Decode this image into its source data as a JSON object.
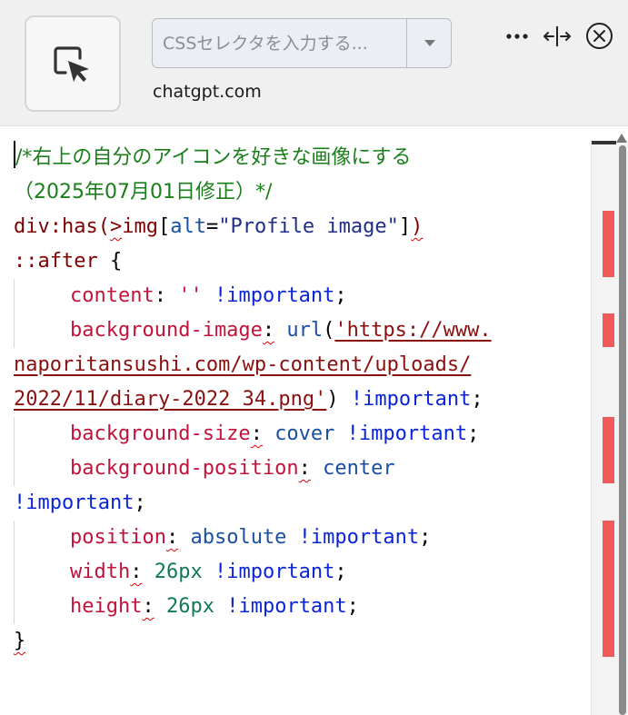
{
  "toolbar": {
    "picker_icon": "element-picker-icon",
    "selector_placeholder": "CSSセレクタを入力する...",
    "selector_value": "",
    "domain": "chatgpt.com",
    "more_icon": "more-dots-icon",
    "split_icon": "split-view-icon",
    "close_icon": "close-circle-icon"
  },
  "editor": {
    "lines": [
      [
        {
          "t": "/*右上の自分のアイコンを好きな画像にする",
          "c": "c-comment"
        }
      ],
      [
        {
          "t": "（2025年07月01日修正）*/",
          "c": "c-comment"
        }
      ],
      [
        {
          "t": "div:has(",
          "c": "c-sel"
        },
        {
          "t": ">",
          "c": "c-sel squig"
        },
        {
          "t": "img",
          "c": "c-sel"
        },
        {
          "t": "[",
          "c": "c-punc"
        },
        {
          "t": "alt",
          "c": "c-attr"
        },
        {
          "t": "=",
          "c": "c-punc"
        },
        {
          "t": "\"Profile image\"",
          "c": "c-str"
        },
        {
          "t": "]",
          "c": "c-punc"
        },
        {
          "t": ")",
          "c": "c-sel squig"
        }
      ],
      [
        {
          "t": "::after ",
          "c": "c-sel"
        },
        {
          "t": "{",
          "c": "c-punc"
        }
      ],
      [
        {
          "ind": 1
        },
        {
          "t": "content",
          "c": "c-prop"
        },
        {
          "t": ": ",
          "c": "c-punc"
        },
        {
          "t": "''",
          "c": "c-prop"
        },
        {
          "t": " ",
          "c": "c-punc"
        },
        {
          "t": "!important",
          "c": "c-imp"
        },
        {
          "t": ";",
          "c": "c-punc"
        }
      ],
      [
        {
          "ind": 1
        },
        {
          "t": "background-image",
          "c": "c-prop"
        },
        {
          "t": ":",
          "c": "c-punc squig"
        },
        {
          "t": " ",
          "c": "c-punc"
        },
        {
          "t": "url",
          "c": "c-val"
        },
        {
          "t": "(",
          "c": "c-punc"
        },
        {
          "t": "'https://www.",
          "c": "c-url"
        }
      ],
      [
        {
          "t": "naporitansushi.com/wp-content/uploads/",
          "c": "c-url"
        }
      ],
      [
        {
          "t": "2022/11/diary-2022_34.png'",
          "c": "c-url"
        },
        {
          "t": ") ",
          "c": "c-punc"
        },
        {
          "t": "!important",
          "c": "c-imp"
        },
        {
          "t": ";",
          "c": "c-punc"
        }
      ],
      [
        {
          "ind": 1
        },
        {
          "t": "background-size",
          "c": "c-prop"
        },
        {
          "t": ":",
          "c": "c-punc squig"
        },
        {
          "t": " ",
          "c": "c-punc"
        },
        {
          "t": "cover",
          "c": "c-val"
        },
        {
          "t": " ",
          "c": "c-punc"
        },
        {
          "t": "!important",
          "c": "c-imp"
        },
        {
          "t": ";",
          "c": "c-punc"
        }
      ],
      [
        {
          "ind": 1
        },
        {
          "t": "background-position",
          "c": "c-prop"
        },
        {
          "t": ":",
          "c": "c-punc squig"
        },
        {
          "t": " ",
          "c": "c-punc"
        },
        {
          "t": "center",
          "c": "c-val"
        }
      ],
      [
        {
          "t": "!important",
          "c": "c-imp"
        },
        {
          "t": ";",
          "c": "c-punc"
        }
      ],
      [
        {
          "ind": 1
        },
        {
          "t": "position",
          "c": "c-prop"
        },
        {
          "t": ":",
          "c": "c-punc squig"
        },
        {
          "t": " ",
          "c": "c-punc"
        },
        {
          "t": "absolute",
          "c": "c-val"
        },
        {
          "t": " ",
          "c": "c-punc"
        },
        {
          "t": "!important",
          "c": "c-imp"
        },
        {
          "t": ";",
          "c": "c-punc"
        }
      ],
      [
        {
          "ind": 1
        },
        {
          "t": "width",
          "c": "c-prop"
        },
        {
          "t": ":",
          "c": "c-punc squig"
        },
        {
          "t": " ",
          "c": "c-punc"
        },
        {
          "t": "26px",
          "c": "c-num"
        },
        {
          "t": " ",
          "c": "c-punc"
        },
        {
          "t": "!important",
          "c": "c-imp"
        },
        {
          "t": ";",
          "c": "c-punc"
        }
      ],
      [
        {
          "ind": 1
        },
        {
          "t": "height",
          "c": "c-prop"
        },
        {
          "t": ":",
          "c": "c-punc squig"
        },
        {
          "t": " ",
          "c": "c-punc"
        },
        {
          "t": "26px",
          "c": "c-num"
        },
        {
          "t": " ",
          "c": "c-punc"
        },
        {
          "t": "!important",
          "c": "c-imp"
        },
        {
          "t": ";",
          "c": "c-punc"
        }
      ],
      [
        {
          "t": "}",
          "c": "c-punc squig"
        }
      ]
    ]
  },
  "colors": {
    "toolbar_bg": "#f0f0f0",
    "comment": "#1a7f1a",
    "property": "#c0143c",
    "important": "#0b24d8",
    "error_marker": "#f05a5a"
  }
}
